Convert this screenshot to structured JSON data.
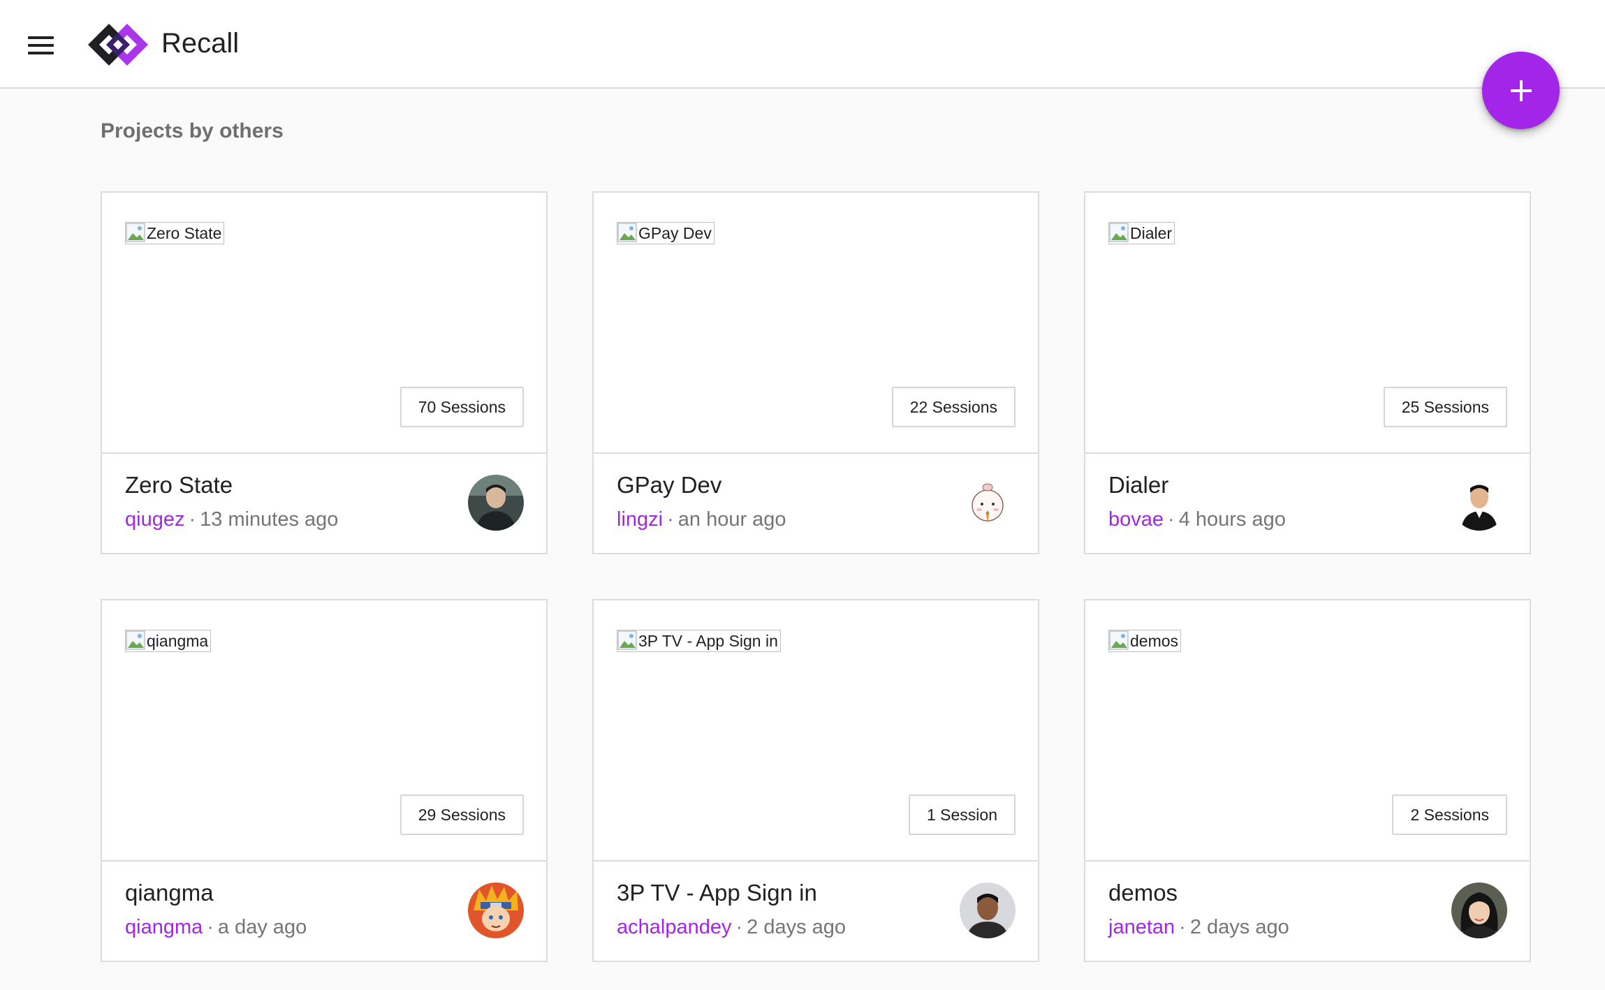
{
  "app": {
    "title": "Recall",
    "brand_color": "#a225e9"
  },
  "header": {
    "menu_icon": "hamburger-menu-icon",
    "logo_icon": "recall-logo-icon",
    "fab_icon": "plus-icon"
  },
  "section": {
    "title": "Projects by others"
  },
  "projects": [
    {
      "name": "Zero State",
      "image_alt": "Zero State",
      "sessions": "70 Sessions",
      "owner": "qiugez",
      "time": "13 minutes ago"
    },
    {
      "name": "GPay Dev",
      "image_alt": "GPay Dev",
      "sessions": "22 Sessions",
      "owner": "lingzi",
      "time": "an hour ago"
    },
    {
      "name": "Dialer",
      "image_alt": "Dialer",
      "sessions": "25 Sessions",
      "owner": "bovae",
      "time": "4 hours ago"
    },
    {
      "name": "qiangma",
      "image_alt": "qiangma",
      "sessions": "29 Sessions",
      "owner": "qiangma",
      "time": "a day ago"
    },
    {
      "name": "3P TV - App Sign in",
      "image_alt": "3P TV - App Sign in",
      "sessions": "1 Session",
      "owner": "achalpandey",
      "time": "2 days ago"
    },
    {
      "name": "demos",
      "image_alt": "demos",
      "sessions": "2 Sessions",
      "owner": "janetan",
      "time": "2 days ago"
    }
  ],
  "separator": "·"
}
